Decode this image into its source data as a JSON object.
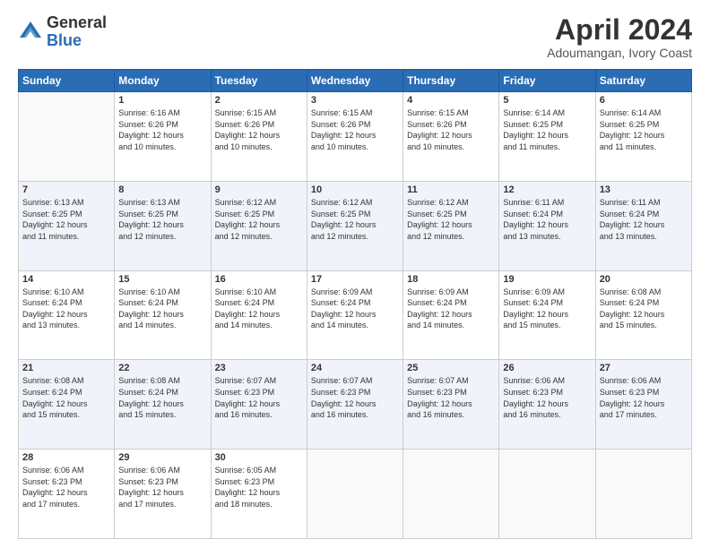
{
  "logo": {
    "general": "General",
    "blue": "Blue"
  },
  "title": "April 2024",
  "subtitle": "Adoumangan, Ivory Coast",
  "days_of_week": [
    "Sunday",
    "Monday",
    "Tuesday",
    "Wednesday",
    "Thursday",
    "Friday",
    "Saturday"
  ],
  "weeks": [
    [
      {
        "day": "",
        "info": ""
      },
      {
        "day": "1",
        "info": "Sunrise: 6:16 AM\nSunset: 6:26 PM\nDaylight: 12 hours\nand 10 minutes."
      },
      {
        "day": "2",
        "info": "Sunrise: 6:15 AM\nSunset: 6:26 PM\nDaylight: 12 hours\nand 10 minutes."
      },
      {
        "day": "3",
        "info": "Sunrise: 6:15 AM\nSunset: 6:26 PM\nDaylight: 12 hours\nand 10 minutes."
      },
      {
        "day": "4",
        "info": "Sunrise: 6:15 AM\nSunset: 6:26 PM\nDaylight: 12 hours\nand 10 minutes."
      },
      {
        "day": "5",
        "info": "Sunrise: 6:14 AM\nSunset: 6:25 PM\nDaylight: 12 hours\nand 11 minutes."
      },
      {
        "day": "6",
        "info": "Sunrise: 6:14 AM\nSunset: 6:25 PM\nDaylight: 12 hours\nand 11 minutes."
      }
    ],
    [
      {
        "day": "7",
        "info": "Sunrise: 6:13 AM\nSunset: 6:25 PM\nDaylight: 12 hours\nand 11 minutes."
      },
      {
        "day": "8",
        "info": "Sunrise: 6:13 AM\nSunset: 6:25 PM\nDaylight: 12 hours\nand 12 minutes."
      },
      {
        "day": "9",
        "info": "Sunrise: 6:12 AM\nSunset: 6:25 PM\nDaylight: 12 hours\nand 12 minutes."
      },
      {
        "day": "10",
        "info": "Sunrise: 6:12 AM\nSunset: 6:25 PM\nDaylight: 12 hours\nand 12 minutes."
      },
      {
        "day": "11",
        "info": "Sunrise: 6:12 AM\nSunset: 6:25 PM\nDaylight: 12 hours\nand 12 minutes."
      },
      {
        "day": "12",
        "info": "Sunrise: 6:11 AM\nSunset: 6:24 PM\nDaylight: 12 hours\nand 13 minutes."
      },
      {
        "day": "13",
        "info": "Sunrise: 6:11 AM\nSunset: 6:24 PM\nDaylight: 12 hours\nand 13 minutes."
      }
    ],
    [
      {
        "day": "14",
        "info": "Sunrise: 6:10 AM\nSunset: 6:24 PM\nDaylight: 12 hours\nand 13 minutes."
      },
      {
        "day": "15",
        "info": "Sunrise: 6:10 AM\nSunset: 6:24 PM\nDaylight: 12 hours\nand 14 minutes."
      },
      {
        "day": "16",
        "info": "Sunrise: 6:10 AM\nSunset: 6:24 PM\nDaylight: 12 hours\nand 14 minutes."
      },
      {
        "day": "17",
        "info": "Sunrise: 6:09 AM\nSunset: 6:24 PM\nDaylight: 12 hours\nand 14 minutes."
      },
      {
        "day": "18",
        "info": "Sunrise: 6:09 AM\nSunset: 6:24 PM\nDaylight: 12 hours\nand 14 minutes."
      },
      {
        "day": "19",
        "info": "Sunrise: 6:09 AM\nSunset: 6:24 PM\nDaylight: 12 hours\nand 15 minutes."
      },
      {
        "day": "20",
        "info": "Sunrise: 6:08 AM\nSunset: 6:24 PM\nDaylight: 12 hours\nand 15 minutes."
      }
    ],
    [
      {
        "day": "21",
        "info": "Sunrise: 6:08 AM\nSunset: 6:24 PM\nDaylight: 12 hours\nand 15 minutes."
      },
      {
        "day": "22",
        "info": "Sunrise: 6:08 AM\nSunset: 6:24 PM\nDaylight: 12 hours\nand 15 minutes."
      },
      {
        "day": "23",
        "info": "Sunrise: 6:07 AM\nSunset: 6:23 PM\nDaylight: 12 hours\nand 16 minutes."
      },
      {
        "day": "24",
        "info": "Sunrise: 6:07 AM\nSunset: 6:23 PM\nDaylight: 12 hours\nand 16 minutes."
      },
      {
        "day": "25",
        "info": "Sunrise: 6:07 AM\nSunset: 6:23 PM\nDaylight: 12 hours\nand 16 minutes."
      },
      {
        "day": "26",
        "info": "Sunrise: 6:06 AM\nSunset: 6:23 PM\nDaylight: 12 hours\nand 16 minutes."
      },
      {
        "day": "27",
        "info": "Sunrise: 6:06 AM\nSunset: 6:23 PM\nDaylight: 12 hours\nand 17 minutes."
      }
    ],
    [
      {
        "day": "28",
        "info": "Sunrise: 6:06 AM\nSunset: 6:23 PM\nDaylight: 12 hours\nand 17 minutes."
      },
      {
        "day": "29",
        "info": "Sunrise: 6:06 AM\nSunset: 6:23 PM\nDaylight: 12 hours\nand 17 minutes."
      },
      {
        "day": "30",
        "info": "Sunrise: 6:05 AM\nSunset: 6:23 PM\nDaylight: 12 hours\nand 18 minutes."
      },
      {
        "day": "",
        "info": ""
      },
      {
        "day": "",
        "info": ""
      },
      {
        "day": "",
        "info": ""
      },
      {
        "day": "",
        "info": ""
      }
    ]
  ]
}
